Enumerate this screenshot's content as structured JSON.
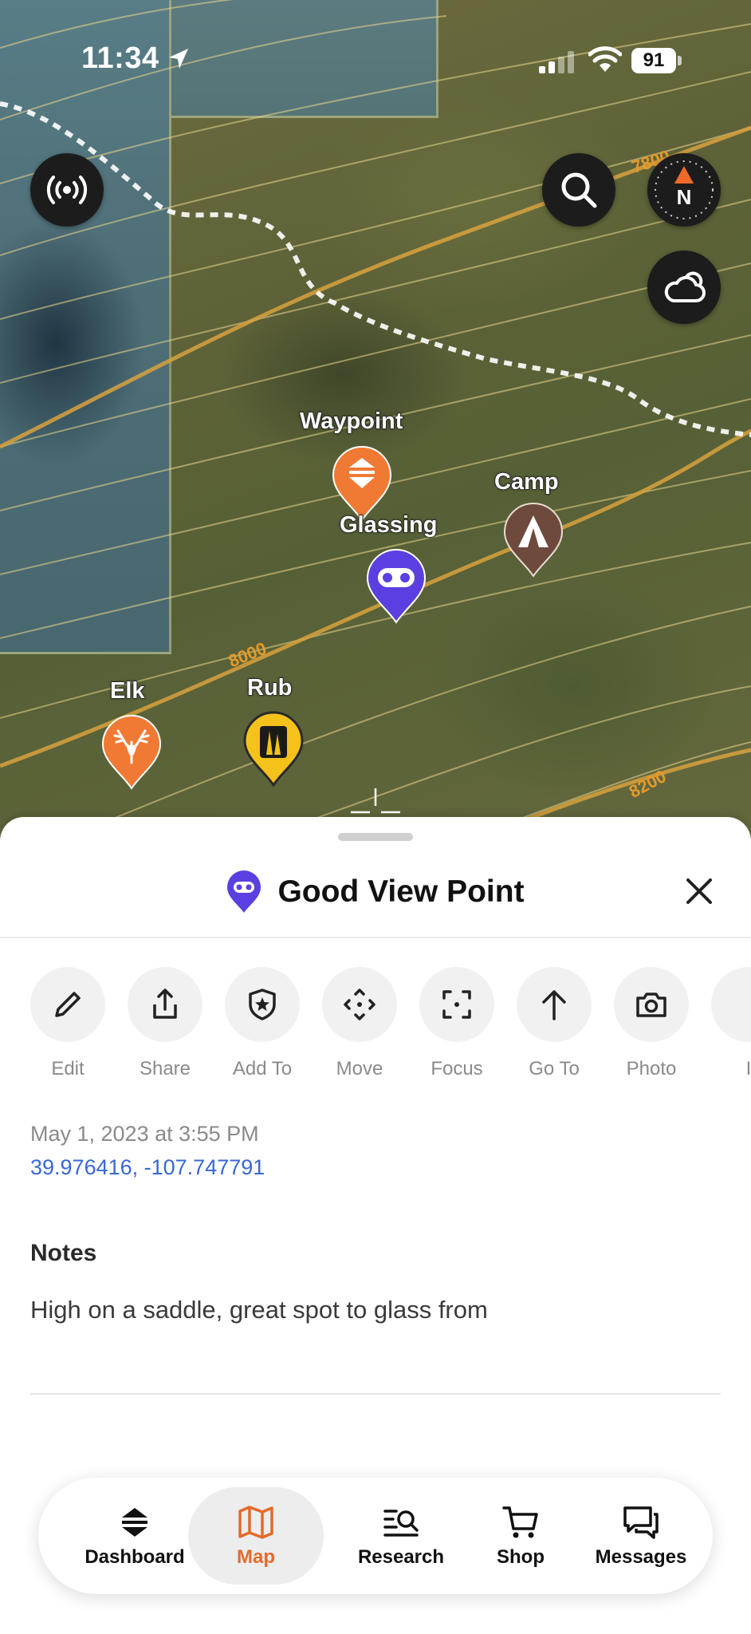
{
  "status_bar": {
    "time": "11:34",
    "battery": "91"
  },
  "map": {
    "pins": [
      {
        "id": "waypoint",
        "label": "Waypoint",
        "color": "#f07a34",
        "icon": "waypoint-icon"
      },
      {
        "id": "camp",
        "label": "Camp",
        "color": "#6e4a3c",
        "icon": "tent-icon"
      },
      {
        "id": "glassing",
        "label": "Glassing",
        "color": "#5b3fe0",
        "icon": "binoculars-icon"
      },
      {
        "id": "elk",
        "label": "Elk",
        "color": "#f07a34",
        "icon": "elk-icon"
      },
      {
        "id": "rub",
        "label": "Rub",
        "color": "#f4c21a",
        "icon": "rub-icon"
      }
    ],
    "contour_labels": [
      "7800",
      "8000",
      "8200"
    ],
    "compass_label": "N"
  },
  "sheet": {
    "title": "Good View Point",
    "actions": [
      {
        "label": "Edit",
        "icon": "pencil-icon"
      },
      {
        "label": "Share",
        "icon": "share-icon"
      },
      {
        "label": "Add To",
        "icon": "shield-star-icon"
      },
      {
        "label": "Move",
        "icon": "move-icon"
      },
      {
        "label": "Focus",
        "icon": "focus-icon"
      },
      {
        "label": "Go To",
        "icon": "arrow-up-icon"
      },
      {
        "label": "Photo",
        "icon": "camera-icon"
      },
      {
        "label": "I",
        "icon": "more-icon"
      }
    ],
    "date": "May 1, 2023 at 3:55 PM",
    "coordinates": "39.976416, -107.747791",
    "notes_heading": "Notes",
    "notes_body": "High on a saddle, great spot to glass from"
  },
  "tabbar": {
    "tabs": [
      {
        "label": "Dashboard",
        "icon": "dashboard-icon",
        "active": false
      },
      {
        "label": "Map",
        "icon": "map-icon",
        "active": true
      },
      {
        "label": "Research",
        "icon": "research-icon",
        "active": false
      },
      {
        "label": "Shop",
        "icon": "cart-icon",
        "active": false
      },
      {
        "label": "Messages",
        "icon": "messages-icon",
        "active": false
      }
    ]
  },
  "colors": {
    "accent": "#e56a2b",
    "link": "#3867d6",
    "glassing": "#5b3fe0"
  }
}
